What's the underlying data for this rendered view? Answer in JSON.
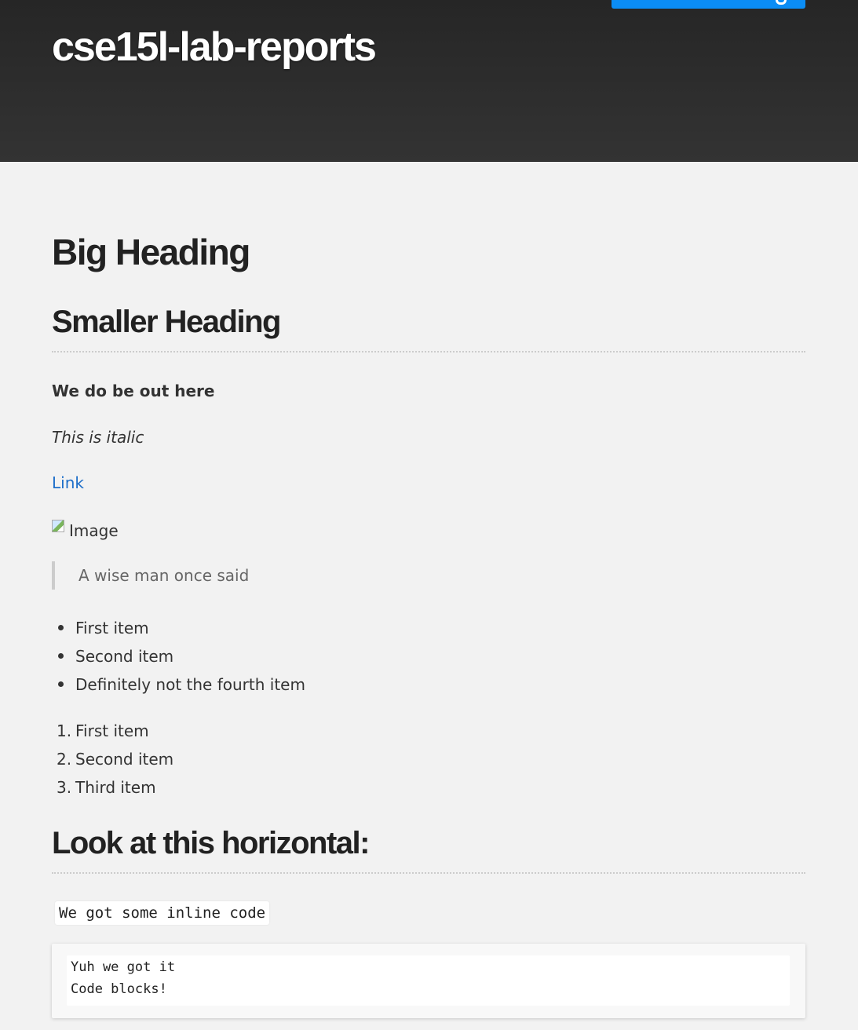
{
  "header": {
    "site_title": "cse15l-lab-reports"
  },
  "content": {
    "big_heading": "Big Heading",
    "smaller_heading": "Smaller Heading",
    "bold_text": "We do be out here",
    "italic_text": "This is italic",
    "link_text": "Link",
    "image_alt": "Image",
    "blockquote": "A wise man once said",
    "unordered_list": [
      "First item",
      "Second item",
      "Definitely not the fourth item"
    ],
    "ordered_list": [
      {
        "num": "1.",
        "label": "First item"
      },
      {
        "num": "2.",
        "label": "Second item"
      },
      {
        "num": "3.",
        "label": "Third item"
      }
    ],
    "horizontal_heading": "Look at this horizontal:",
    "inline_code": "We got some inline code",
    "code_block_lines": [
      "Yuh we got it",
      "Code blocks!"
    ]
  },
  "icons": {
    "header_button_icon": "github-icon",
    "image_placeholder_icon": "broken-image-icon"
  },
  "colors": {
    "header_bg": "#2b2b2b",
    "page_bg": "#f2f2f2",
    "button_accent": "#0b8df5",
    "link": "#1e6fc9",
    "quote_text": "#666666"
  }
}
